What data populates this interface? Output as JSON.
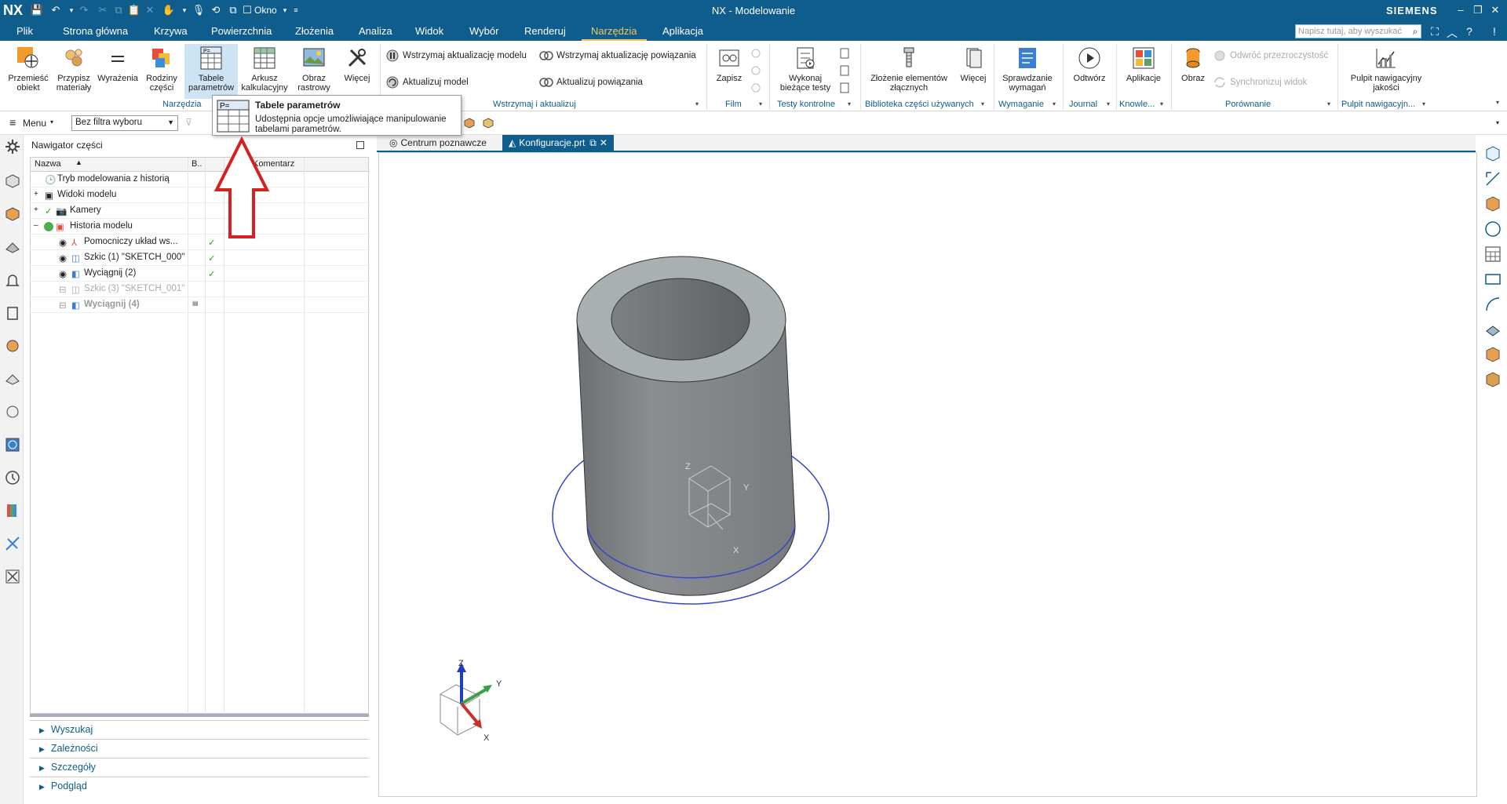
{
  "titlebar": {
    "logo": "NX",
    "title": "NX - Modelowanie",
    "brand": "SIEMENS",
    "window_menu": "Okno",
    "color": "#0f5d8c"
  },
  "menubar": {
    "items": [
      "Plik",
      "Strona główna",
      "Krzywa",
      "Powierzchnia",
      "Złożenia",
      "Analiza",
      "Widok",
      "Wybór",
      "Renderuj",
      "Narzędzia",
      "Aplikacja"
    ],
    "active": "Narzędzia",
    "search_placeholder": "Napisz tutaj, aby wyszukać",
    "active_color": "#f3c65a"
  },
  "ribbon": {
    "buttons": {
      "move": "Przemieść obiekt",
      "material": "Przypisz materiały",
      "expressions": "Wyrażenia",
      "families": "Rodziny części",
      "param_tables": "Tabele parametrów",
      "spreadsheet": "Arkusz kalkulacyjny",
      "image": "Obraz rastrowy",
      "more": "Więcej"
    },
    "small": {
      "suspend_model": "Wstrzymaj aktualizację modelu",
      "update_model": "Aktualizuj model",
      "suspend_links": "Wstrzymaj aktualizację powiązania",
      "update_links": "Aktualizuj powiązania",
      "reverse_transparency": "Odwróć przezroczystość",
      "sync_view": "Synchronizuj widok"
    },
    "buttons2": {
      "save": "Zapisz",
      "run_tests": "Wykonaj bieżące testy",
      "assembly": "Złożenie elementów złącznych",
      "more2": "Więcej",
      "req_check": "Sprawdzanie wymagań",
      "open": "Odtwórz",
      "apps": "Aplikacje",
      "image2": "Obraz",
      "quality": "Pulpit nawigacyjny jakości"
    },
    "groups": {
      "tools": "Narzędzia",
      "suspend": "Wstrzymaj i aktualizuj",
      "film": "Film",
      "tests": "Testy kontrolne",
      "library": "Biblioteka części używanych",
      "requirements": "Wymaganie",
      "journal": "Journal",
      "knowledge": "Knowle...",
      "compare": "Porównanie",
      "dashboard": "Pulpit nawigacyjn..."
    }
  },
  "toolbar2": {
    "menu": "Menu",
    "filter": "Bez filtra wyboru"
  },
  "tooltip": {
    "title": "Tabele parametrów",
    "description": "Udostępnia opcje umożliwiające manipulowanie tabelami parametrów."
  },
  "navigator": {
    "title": "Nawigator części",
    "columns": [
      "Nazwa",
      "B..",
      "",
      "Komentarz"
    ],
    "rows": [
      {
        "label": "Tryb modelowania z historią",
        "check": ""
      },
      {
        "label": "Widoki modelu",
        "check": ""
      },
      {
        "label": "Kamery",
        "check": ""
      },
      {
        "label": "Historia modelu",
        "check": ""
      },
      {
        "label": "Pomocniczy układ ws...",
        "check": "✓"
      },
      {
        "label": "Szkic (1) \"SKETCH_000\"",
        "check": "✓"
      },
      {
        "label": "Wyciągnij (2)",
        "check": "✓"
      },
      {
        "label": "Szkic (3) \"SKETCH_001\"",
        "check": ""
      },
      {
        "label": "Wyciągnij (4)",
        "check": ""
      }
    ],
    "sections": [
      "Wyszukaj",
      "Zależności",
      "Szczegóły",
      "Podgląd"
    ]
  },
  "tabs": [
    {
      "label": "Centrum poznawcze"
    },
    {
      "label": "Konfiguracje.prt"
    }
  ],
  "viewport": {
    "axis": {
      "x": "X",
      "y": "Y",
      "z": "Z"
    }
  }
}
